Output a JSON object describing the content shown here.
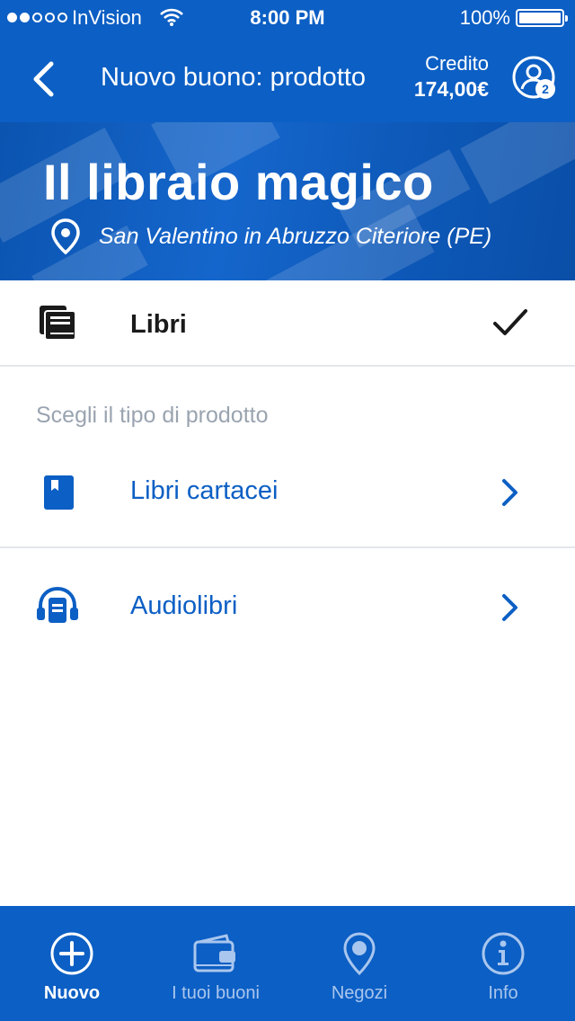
{
  "status_bar": {
    "carrier": "InVision",
    "time": "8:00 PM",
    "battery": "100%",
    "battery_level": 1.0,
    "signal_bars": 2
  },
  "nav": {
    "back_icon": "chevron-left-icon",
    "title": "Nuovo buono: prodotto",
    "credit_label": "Credito",
    "credit_value": "174,00€",
    "profile_badge": "2"
  },
  "hero": {
    "shop_name": "Il libraio magico",
    "location": "San Valentino in Abruzzo Citeriore (PE)"
  },
  "category": {
    "label": "Libri",
    "icon": "books-icon",
    "selected": true
  },
  "section": {
    "header": "Scegli il tipo di prodotto"
  },
  "options": [
    {
      "label": "Libri cartacei",
      "icon": "book-icon"
    },
    {
      "label": "Audiolibri",
      "icon": "audiobook-icon"
    }
  ],
  "tabs": [
    {
      "label": "Nuovo",
      "icon": "plus-circle-icon",
      "active": true
    },
    {
      "label": "I tuoi buoni",
      "icon": "wallet-icon",
      "active": false
    },
    {
      "label": "Negozi",
      "icon": "map-pin-icon",
      "active": false
    },
    {
      "label": "Info",
      "icon": "info-icon",
      "active": false
    }
  ],
  "colors": {
    "primary": "#0c5fc4",
    "link": "#0c5fc4",
    "muted": "#9aa4b0",
    "tab_inactive": "#a9c6ee"
  }
}
